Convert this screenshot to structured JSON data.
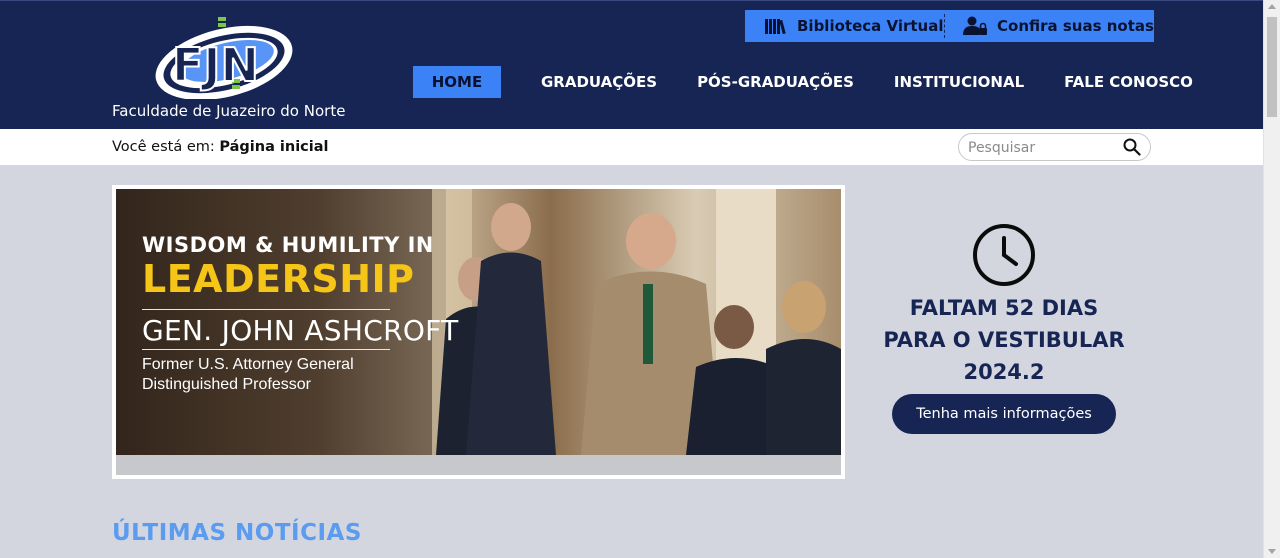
{
  "header": {
    "logo_text": "FJN",
    "logo_caption": "Faculdade de Juazeiro do Norte",
    "top_links": [
      {
        "label": "Biblioteca Virtual",
        "icon": "books-icon"
      },
      {
        "label": "Confira suas notas",
        "icon": "user-lock-icon"
      }
    ],
    "nav": [
      {
        "label": "HOME",
        "active": true
      },
      {
        "label": "GRADUAÇÕES",
        "active": false
      },
      {
        "label": "PÓS-GRADUAÇÕES",
        "active": false
      },
      {
        "label": "INSTITUCIONAL",
        "active": false
      },
      {
        "label": "FALE CONOSCO",
        "active": false
      }
    ]
  },
  "breadcrumb": {
    "prefix": "Você está em:",
    "current": "Página inicial"
  },
  "search": {
    "placeholder": "Pesquisar",
    "icon": "search-icon"
  },
  "banner": {
    "line1": "WISDOM & HUMILITY IN",
    "line2": "LEADERSHIP",
    "line3": "GEN. JOHN ASHCROFT",
    "line4": "Former U.S. Attorney General",
    "line5": "Distinguished Professor"
  },
  "countdown": {
    "icon": "clock-icon",
    "line1": "FALTAM 52 DIAS",
    "line2": "PARA O VESTIBULAR",
    "line3": "2024.2",
    "button_label": "Tenha mais informações"
  },
  "news": {
    "title": "ÚLTIMAS NOTÍCIAS"
  },
  "colors": {
    "header_bg": "#172554",
    "accent_blue": "#3b82f6",
    "page_bg": "#d3d6de",
    "news_title": "#5b9cf0",
    "banner_yellow": "#f5c518"
  }
}
